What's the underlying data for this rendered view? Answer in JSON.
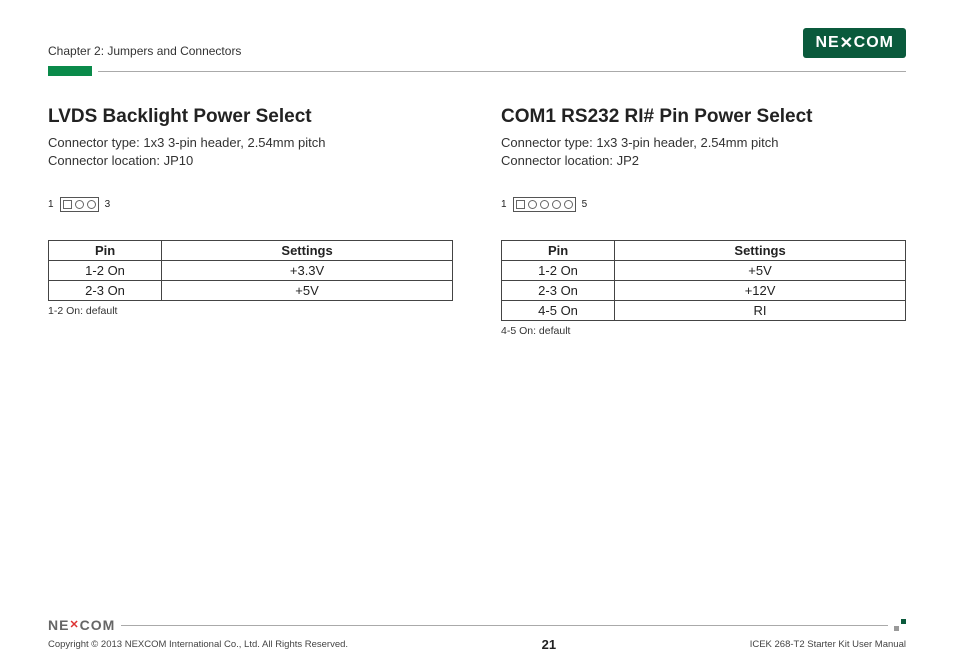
{
  "header": {
    "chapter": "Chapter 2: Jumpers and Connectors",
    "logo": "NEXCOM"
  },
  "left": {
    "title": "LVDS Backlight Power Select",
    "connector_type": "Connector type: 1x3 3-pin header, 2.54mm pitch",
    "connector_loc": "Connector location: JP10",
    "jumper_start": "1",
    "jumper_end": "3",
    "col_pin": "Pin",
    "col_set": "Settings",
    "rows": [
      {
        "pin": "1-2 On",
        "set": "+3.3V"
      },
      {
        "pin": "2-3 On",
        "set": "+5V"
      }
    ],
    "note": "1-2 On: default"
  },
  "right": {
    "title": "COM1 RS232 RI# Pin Power Select",
    "connector_type": "Connector type: 1x3 3-pin header, 2.54mm pitch",
    "connector_loc": "Connector location: JP2",
    "jumper_start": "1",
    "jumper_end": "5",
    "col_pin": "Pin",
    "col_set": "Settings",
    "rows": [
      {
        "pin": "1-2 On",
        "set": "+5V"
      },
      {
        "pin": "2-3 On",
        "set": "+12V"
      },
      {
        "pin": "4-5 On",
        "set": "RI"
      }
    ],
    "note": "4-5 On: default"
  },
  "footer": {
    "logo": "NEXCOM",
    "copyright": "Copyright © 2013 NEXCOM International Co., Ltd. All Rights Reserved.",
    "page": "21",
    "manual": "ICEK 268-T2 Starter Kit User Manual"
  }
}
